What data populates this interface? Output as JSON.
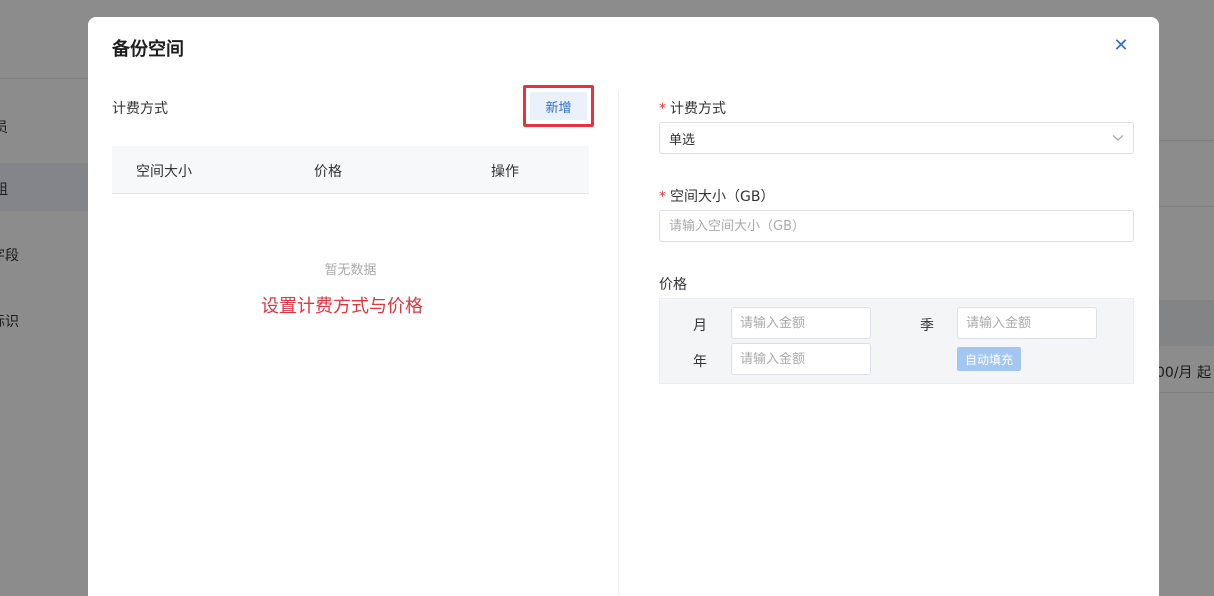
{
  "background": {
    "left_items": [
      "员",
      "组",
      "字段",
      "标识"
    ],
    "right_text": "00/月 起"
  },
  "modal": {
    "title": "备份空间",
    "close_icon": "close-icon",
    "left": {
      "section_label": "计费方式",
      "add_button": "新增",
      "table_headers": [
        "空间大小",
        "价格",
        "操作"
      ],
      "empty_text": "暂无数据",
      "annotation": "设置计费方式与价格"
    },
    "right": {
      "billing_label": "计费方式",
      "billing_value": "单选",
      "size_label": "空间大小（GB）",
      "size_placeholder": "请输入空间大小（GB）",
      "price_label": "价格",
      "month_label": "月",
      "quarter_label": "季",
      "year_label": "年",
      "amount_placeholder": "请输入金额",
      "autofill_button": "自动填充"
    }
  },
  "colors": {
    "accent": "#2f6fd6",
    "required": "#e3353b",
    "highlight_border": "#e3353b"
  }
}
